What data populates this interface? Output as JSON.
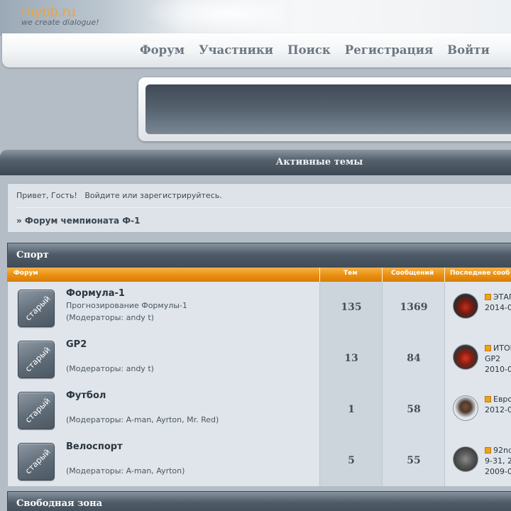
{
  "logo": {
    "brand": "mybb.ru",
    "tagline": "we create dialogue!"
  },
  "nav": {
    "items": [
      "Форум",
      "Участники",
      "Поиск",
      "Регистрация",
      "Войти"
    ]
  },
  "active_topics": "Активные темы",
  "welcome": {
    "greeting": "Привет, Гость!",
    "login_prompt": "Войдите или зарегистрируйтесь.",
    "breadcrumb": "» Форум чемпионата Ф-1"
  },
  "categories": [
    {
      "name": "Спорт",
      "columns": {
        "forum": "Форум",
        "topics": "Тем",
        "posts": "Сообщений",
        "last_post": "Последнее сооб"
      },
      "forums": [
        {
          "badge": "старый",
          "name": "Формула-1",
          "description": "Прогнозирование Формулы-1",
          "moderators": "(Модераторы: andy t)",
          "topics": "135",
          "posts": "1369",
          "last_topic": "ЭТАП",
          "last_topic_2": "",
          "last_date": "2014-0"
        },
        {
          "badge": "старый",
          "name": "GP2",
          "description": "",
          "moderators": "(Модераторы: andy t)",
          "topics": "13",
          "posts": "84",
          "last_topic": "ИТОГ",
          "last_topic_2": "GP2",
          "last_date": "2010-0"
        },
        {
          "badge": "старый",
          "name": "Футбол",
          "description": "",
          "moderators": "(Модераторы: A-man, Ayrton, Mr. Red)",
          "topics": "1",
          "posts": "58",
          "last_topic": "Евро",
          "last_topic_2": "",
          "last_date": "2012-0"
        },
        {
          "badge": "старый",
          "name": "Велоспорт",
          "description": "",
          "moderators": "(Модераторы: A-man, Ayrton)",
          "topics": "5",
          "posts": "55",
          "last_topic": "92nd",
          "last_topic_2": "9-31, 2",
          "last_date": "2009-0"
        }
      ]
    },
    {
      "name": "Свободная зона"
    }
  ],
  "colors": {
    "accent_orange": "#e98f10",
    "header_dark": "#4f5c68",
    "panel": "#dfe5eb"
  }
}
